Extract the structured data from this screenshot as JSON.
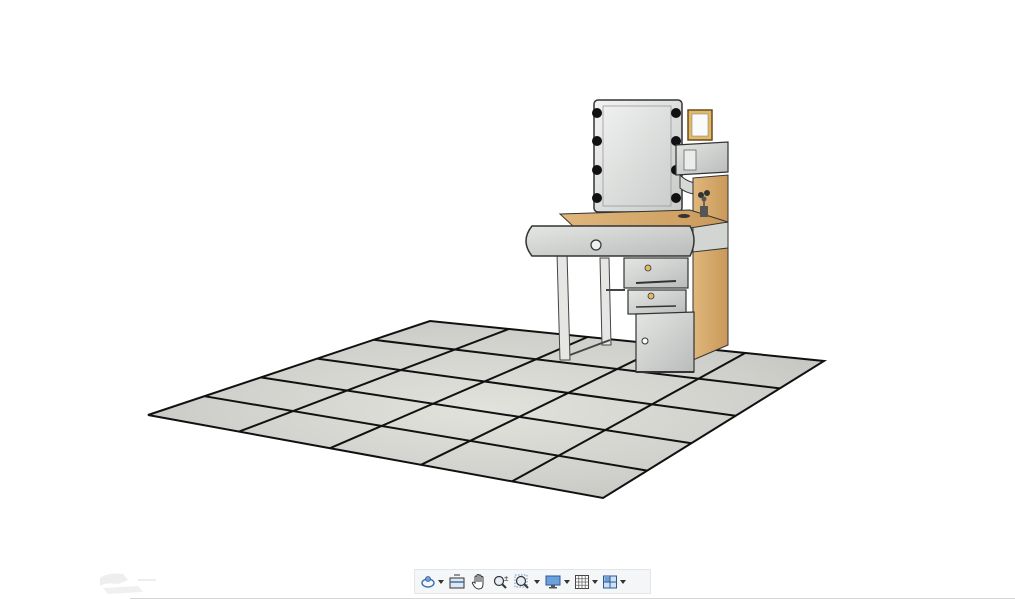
{
  "toolbar": {
    "items": [
      {
        "name": "orbit-tool-icon",
        "has_dropdown": true
      },
      {
        "name": "section-view-icon",
        "has_dropdown": false
      },
      {
        "name": "pan-hand-icon",
        "has_dropdown": false
      },
      {
        "name": "zoom-in-out-icon",
        "has_dropdown": false
      },
      {
        "name": "zoom-window-icon",
        "has_dropdown": true
      },
      {
        "name": "display-mode-icon",
        "has_dropdown": true
      },
      {
        "name": "grid-icon",
        "has_dropdown": true
      },
      {
        "name": "views-layout-icon",
        "has_dropdown": true
      }
    ],
    "icon_color": "#3a6fb0"
  },
  "scene": {
    "background": "#ffffff",
    "floor_tile_color": "#d9d9d4",
    "grout_color": "#111111",
    "wood_color": "#d8ae72",
    "panel_color": "#cfd2cf"
  }
}
